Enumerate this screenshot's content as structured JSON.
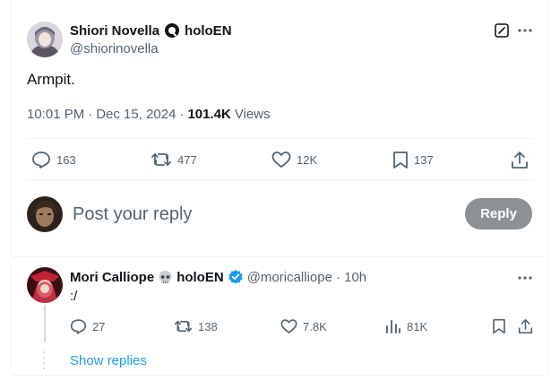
{
  "post": {
    "author_name": "Shiori Novella",
    "affiliation": "holoEN",
    "handle": "@shiorinovella",
    "text": "Armpit.",
    "time": "10:01 PM",
    "date": "Dec 15, 2024",
    "views_count": "101.4K",
    "views_label": "Views",
    "separator": "·",
    "stats": {
      "replies": "163",
      "reposts": "477",
      "likes": "12K",
      "bookmarks": "137"
    }
  },
  "composer": {
    "placeholder": "Post your reply",
    "reply_button": "Reply"
  },
  "reply": {
    "author_name": "Mori Calliope",
    "affiliation": "holoEN",
    "handle": "@moricalliope",
    "age": "· 10h",
    "text": ":/",
    "stats": {
      "replies": "27",
      "reposts": "138",
      "likes": "7.8K",
      "views": "81K"
    }
  },
  "show_replies": "Show replies",
  "colors": {
    "accent": "#1d9bf0",
    "muted": "#536471",
    "reply_button_bg": "#8c9196",
    "badge": "#1d9bf0"
  },
  "icons": [
    "grok-icon",
    "edit-icon",
    "reply-icon",
    "repost-icon",
    "like-icon",
    "bookmark-icon",
    "share-icon",
    "more-icon",
    "skull-icon",
    "verified-badge-icon",
    "views-icon"
  ]
}
